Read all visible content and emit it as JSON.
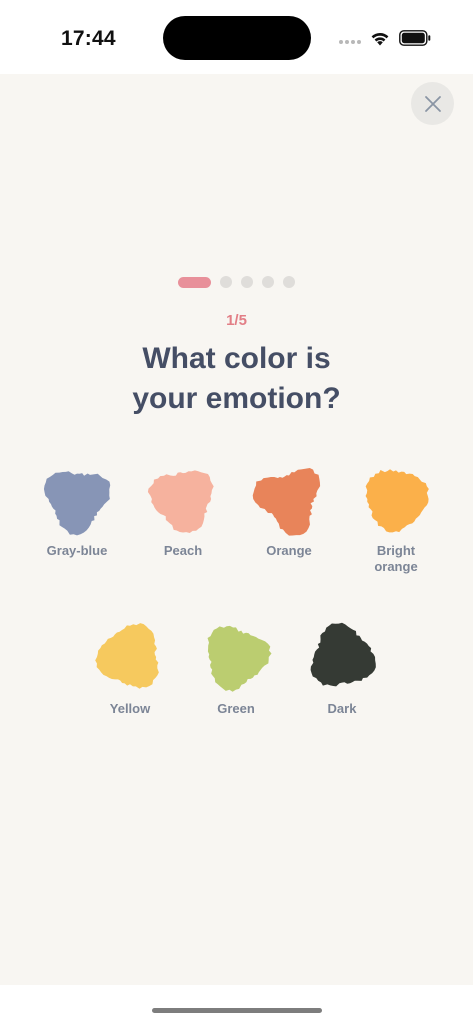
{
  "status_bar": {
    "time": "17:44"
  },
  "progress": {
    "current": 1,
    "total": 5,
    "counter_text": "1/5",
    "active_color": "#e8909a"
  },
  "question": {
    "line1": "What color is",
    "line2": "your emotion?"
  },
  "options": [
    {
      "label": "Gray-blue",
      "color": "#8795b6"
    },
    {
      "label": "Peach",
      "color": "#f6b29e"
    },
    {
      "label": "Orange",
      "color": "#e8845a"
    },
    {
      "label": "Bright orange",
      "color": "#fbb04a"
    },
    {
      "label": "Yellow",
      "color": "#f6c95e"
    },
    {
      "label": "Green",
      "color": "#bbcd70"
    },
    {
      "label": "Dark",
      "color": "#353a34"
    }
  ],
  "icons": {
    "close": "close-icon",
    "wifi": "wifi-icon",
    "battery": "battery-icon",
    "signal": "signal-icon"
  }
}
